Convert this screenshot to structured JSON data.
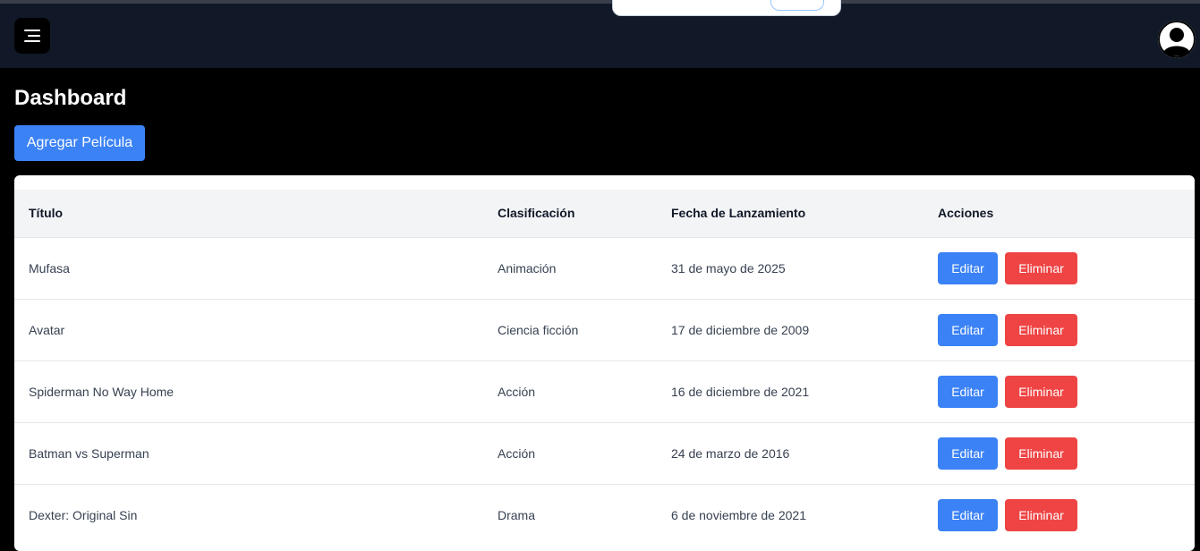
{
  "header": {
    "menu_icon": "menu-icon",
    "avatar_icon": "user-avatar-icon"
  },
  "page": {
    "title": "Dashboard",
    "add_button": "Agregar Película"
  },
  "table": {
    "columns": [
      "Título",
      "Clasificación",
      "Fecha de Lanzamiento",
      "Acciones"
    ],
    "rows": [
      {
        "title": "Mufasa",
        "classification": "Animación",
        "release": "31 de mayo de 2025"
      },
      {
        "title": "Avatar",
        "classification": "Ciencia ficción",
        "release": "17 de diciembre de 2009"
      },
      {
        "title": "Spiderman No Way Home",
        "classification": "Acción",
        "release": "16 de diciembre de 2021"
      },
      {
        "title": "Batman vs Superman",
        "classification": "Acción",
        "release": "24 de marzo de 2016"
      },
      {
        "title": "Dexter: Original Sin",
        "classification": "Drama",
        "release": "6 de noviembre de 2021"
      }
    ],
    "edit_label": "Editar",
    "delete_label": "Eliminar"
  },
  "colors": {
    "topbar": "#111827",
    "primary": "#3b82f6",
    "danger": "#ef4444",
    "background": "#000000"
  }
}
